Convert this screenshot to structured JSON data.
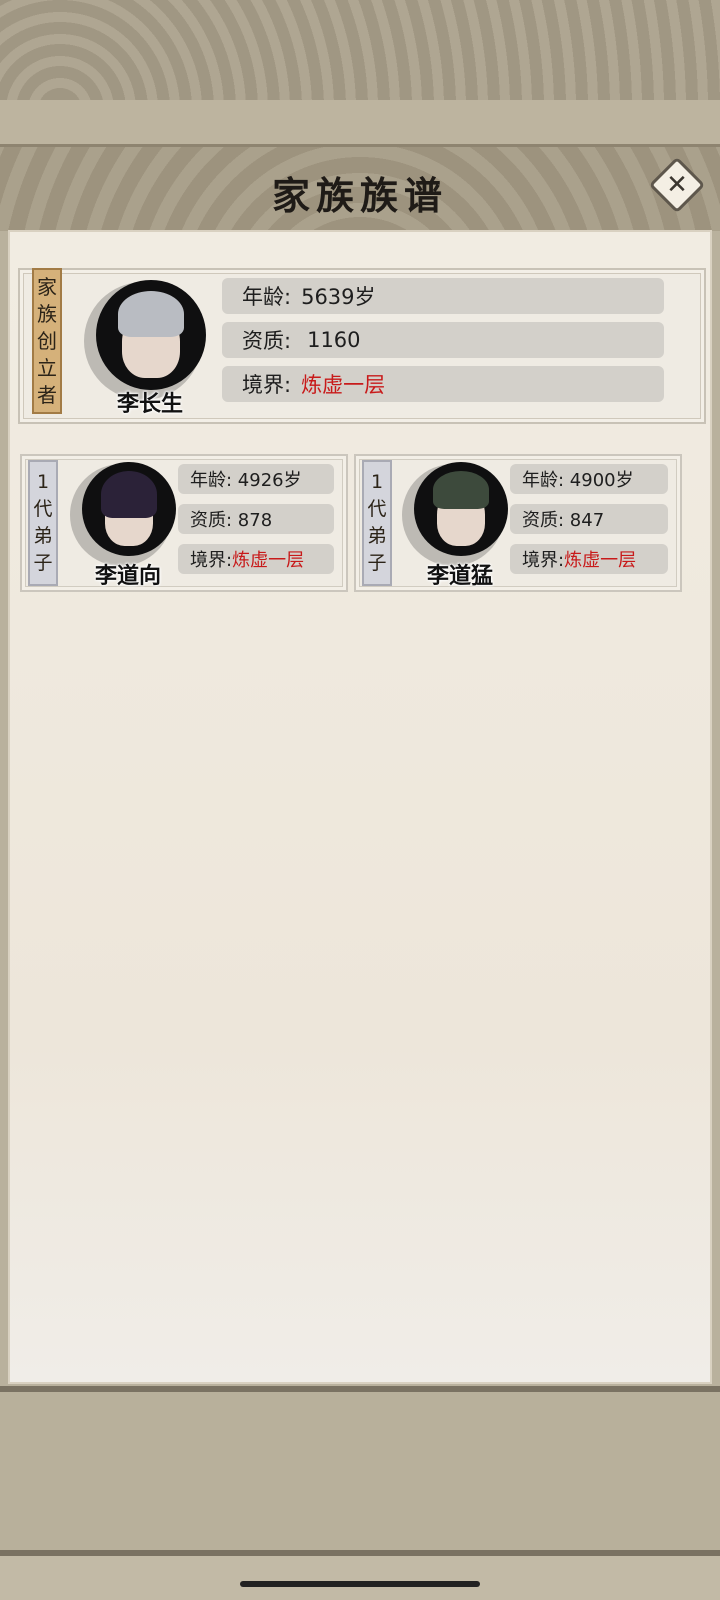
{
  "header": {
    "title": "家族族谱"
  },
  "founder": {
    "tag": [
      "家",
      "族",
      "创",
      "立",
      "者"
    ],
    "name": "李长生",
    "age_label": "年龄:",
    "age_value": "5639岁",
    "aptitude_label": "资质:",
    "aptitude_value": "1160",
    "realm_label": "境界:",
    "realm_value": "炼虚一层"
  },
  "disciples": [
    {
      "tag": [
        "1",
        "代",
        "弟",
        "子"
      ],
      "name": "李道向",
      "age": "年龄: 4926岁",
      "aptitude": "资质: 878",
      "realm_label": "境界:",
      "realm_value": "炼虚一层"
    },
    {
      "tag": [
        "1",
        "代",
        "弟",
        "子"
      ],
      "name": "李道猛",
      "age": "年龄: 4900岁",
      "aptitude": "资质: 847",
      "realm_label": "境界:",
      "realm_value": "炼虚一层"
    }
  ],
  "colors": {
    "realm": "#c81a1a",
    "founder_tag": "#d5b17a",
    "disciple_tag": "#d4d5dc"
  },
  "icons": {
    "close": "close-icon"
  }
}
